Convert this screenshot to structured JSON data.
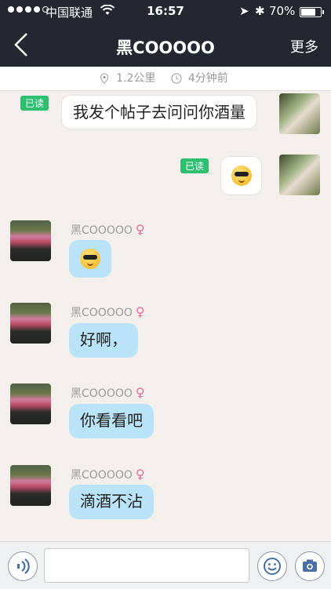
{
  "status": {
    "carrier": "中国联通",
    "time": "16:57",
    "battery": "70%"
  },
  "nav": {
    "title": "黑COOOOO",
    "more": "更多"
  },
  "info": {
    "distance": "1.2公里",
    "time_ago": "4分钟前"
  },
  "messages": {
    "read_label": "已读",
    "out1": "我发个帖子去问问你酒量",
    "sender_name": "黑COOOOO",
    "female_symbol": "♀",
    "in2": "好啊，",
    "in3": "你看看吧",
    "in4": "滴酒不沾"
  },
  "input": {
    "placeholder": ""
  },
  "icons": {
    "back": "back-chevron-icon",
    "location": "location-pin-icon",
    "clock": "clock-icon",
    "voice": "voice-icon",
    "emoji": "smiley-icon",
    "camera": "camera-icon"
  }
}
